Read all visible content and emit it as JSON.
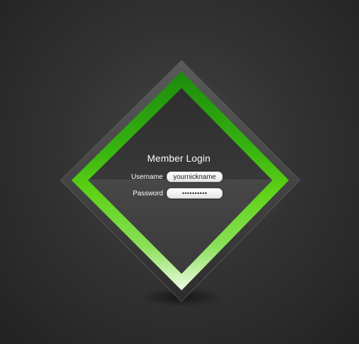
{
  "login": {
    "title": "Member Login",
    "username_label": "Username",
    "username_value": "yournickname",
    "password_label": "Password",
    "password_value": "••••••••••"
  },
  "colors": {
    "background": "#2f2f2f",
    "frame_green_dark": "#1e8a0e",
    "frame_green_mid": "#4cc412",
    "frame_green_light": "#e3f7d5",
    "panel_dark": "#3a3a3a"
  }
}
